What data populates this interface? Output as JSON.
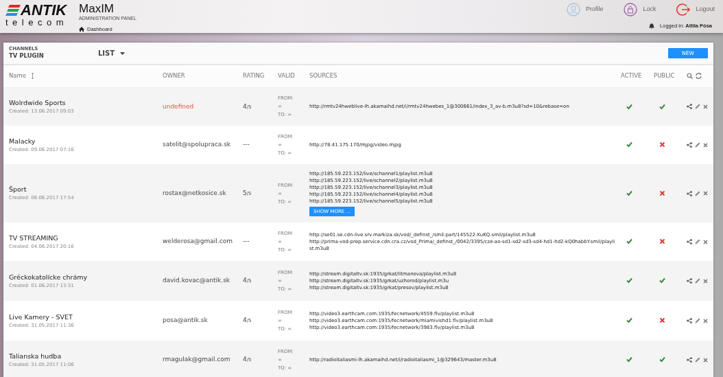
{
  "header": {
    "logo": {
      "brand": "ANTIK",
      "sub": "telecom"
    },
    "app_title": "MaxIM",
    "app_subtitle": "ADMINISTRATION PANEL",
    "breadcrumb": "Dashboard",
    "actions": [
      {
        "kind": "profile",
        "label": "Profile"
      },
      {
        "kind": "lock",
        "label": "Lock"
      },
      {
        "kind": "logout",
        "label": "Logout"
      }
    ],
    "logged_in": "Logged in: **Attila Pósa**"
  },
  "panel": {
    "section": "CHANNELS",
    "title": "TV PLUGIN",
    "view": "LIST",
    "new_button": "NEW"
  },
  "table": {
    "columns": [
      "Name",
      "OWNER",
      "RATING",
      "VALID",
      "SOURCES",
      "ACTIVE",
      "PUBLIC"
    ],
    "rows": [
      {
        "name": "Wolrdwide Sports",
        "created": "Created: 13.06.2017 09:03",
        "owner": "undefined",
        "owner_missing": true,
        "rating": "4",
        "scale": "/5",
        "from_label": "FROM:",
        "from": "∞",
        "to": "TO: ∞",
        "sources": [
          "http://rmtv24hweblive-lh.akamaihd.net/i/rmtv24hwebes_1@300661/index_3_av-b.m3u8?sd=10&rebase=on"
        ],
        "active": true,
        "public": true
      },
      {
        "name": "Malacky",
        "created": "Created: 09.06.2017 07:16",
        "owner": "satelit@spolupraca.sk",
        "owner_missing": false,
        "rating": "---",
        "from_label": "FROM:",
        "from": "∞",
        "to": "TO: ∞",
        "sources": [
          "http://78.41.175.170/mjpg/video.mjpg"
        ],
        "active": true,
        "public": false
      },
      {
        "name": "Šport",
        "created": "Created: 06.06.2017 17:54",
        "owner": "rostax@netkosice.sk",
        "owner_missing": false,
        "rating": "5",
        "scale": "/5",
        "from_label": "FROM:",
        "from": "∞",
        "to": "TO: ∞",
        "sources": [
          "http://185.59.223.152/live/schannel1/playlist.m3u8",
          "http://185.59.223.152/live/schannel2/playlist.m3u8",
          "http://185.59.223.152/live/schannel3/playlist.m3u8",
          "http://185.59.223.152/live/schannel4/playlist.m3u8",
          "http://185.59.223.152/live/schannel5/playlist.m3u8"
        ],
        "show_more": "SHOW MORE ...",
        "active": true,
        "public": false
      },
      {
        "name": "TV STREAMING",
        "created": "Created: 04.06.2017 20:16",
        "owner": "welderosa@gmail.com",
        "owner_missing": false,
        "rating": "---",
        "from_label": "FROM:",
        "from": "∞",
        "to": "TO: ∞",
        "sources": [
          "http://se01.se.cdn-live.srv.markiza.sk/vod/_definst_/smil:part/145522-XuKQ.smil/playlist.m3u8",
          "http://prima-vod-prep.service.cdn.cra.cz/vod_Prima/_definst_/0042/3395/cze-ao-sd1-sd2-sd3-sd4-hd1-hd2-kQ0habbY.smil/playlist.m3u8"
        ],
        "active": true,
        "public": false
      },
      {
        "name": "Gréckokatolícke chrámy",
        "created": "Created: 01.06.2017 13:31",
        "owner": "david.kovac@antik.sk",
        "owner_missing": false,
        "rating": "4",
        "scale": "/5",
        "from_label": "FROM:",
        "from": "∞",
        "to": "TO: ∞",
        "sources": [
          "http://stream.digitaltv.sk:1935/grkat/litmanova/playlist.m3u8",
          "http://stream.digitaltv.sk:1935/grkat/uzhorod/playlist.m3u",
          "http://stream.digitaltv.sk:1935/grkat/presov/playlist.m3u8"
        ],
        "active": true,
        "public": true
      },
      {
        "name": "Live Kamery - SVET",
        "created": "Created: 31.05.2017 11:36",
        "owner": "posa@antik.sk",
        "owner_missing": false,
        "rating": "4",
        "scale": "/5",
        "from_label": "FROM:",
        "from": "∞",
        "to": "TO: ∞",
        "sources": [
          "http://video3.earthcam.com:1935/fecnetwork/4559.flv/playlist.m3u8",
          "http://video3.earthcam.com:1935/fecnetwork/miamivishd1.flv/playlist.m3u8",
          "http://video3.earthcam.com:1935/fecnetwork/3983.flv/playlist.m3u8"
        ],
        "active": true,
        "public": false
      },
      {
        "name": "Talianska hudba",
        "created": "Created: 31.05.2017 11:06",
        "owner": "rmagulak@gmail.com",
        "owner_missing": false,
        "rating": "4",
        "scale": "/5",
        "from_label": "FROM:",
        "from": "∞",
        "to": "TO: ∞",
        "sources": [
          "http://radioitaliasmi-lh.akamaihd.net/i/radioitaliasmi_1@329643/master.m3u8"
        ],
        "active": true,
        "public": true
      }
    ]
  }
}
